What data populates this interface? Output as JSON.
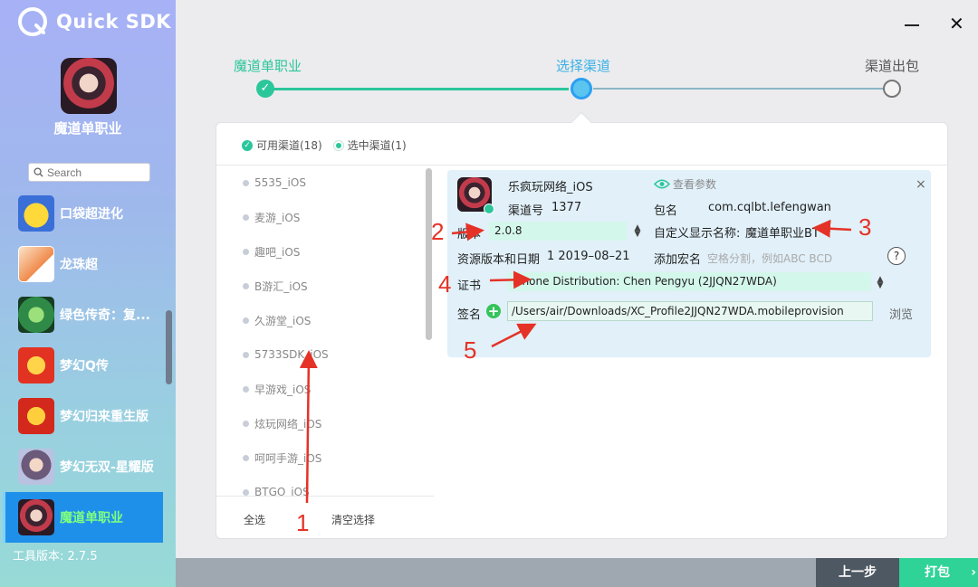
{
  "app": {
    "logo_text": "Quick SDK",
    "tool_version": "工具版本: 2.7.5"
  },
  "project": {
    "name": "魔道单职业"
  },
  "search": {
    "placeholder": "Search"
  },
  "games": [
    {
      "name": "口袋超进化",
      "color": "#3a6fd8",
      "icon": "pikachu-icon"
    },
    {
      "name": "龙珠超",
      "color": "#f08a4b",
      "icon": "dragonball-icon"
    },
    {
      "name": "绿色传奇：复...",
      "color": "#2f8a48",
      "icon": "legend-icon"
    },
    {
      "name": "梦幻Q传",
      "color": "#e23222",
      "icon": "menghuan-q-icon"
    },
    {
      "name": "梦幻归来重生版",
      "color": "#d3281c",
      "icon": "menghuan-return-icon"
    },
    {
      "name": "梦幻无双-星耀版",
      "color": "#8a8fb0",
      "icon": "menghuan-wushuang-icon"
    },
    {
      "name": "魔道单职业",
      "color": "#4b2a35",
      "icon": "modao-icon",
      "active": true
    }
  ],
  "steps": {
    "step1": "魔道单职业",
    "step1_check": "✓",
    "step2": "选择渠道",
    "step3": "渠道出包"
  },
  "tabs": {
    "available": "可用渠道(18)",
    "selected": "选中渠道(1)"
  },
  "channels": [
    "5535_iOS",
    "麦游_iOS",
    "趣吧_iOS",
    "B游汇_iOS",
    "久游堂_iOS",
    "5733SDK_iOS",
    "早游戏_iOS",
    "炫玩网络_iOS",
    "呵呵手游_iOS",
    "BTGO_iOS"
  ],
  "list_footer": {
    "select_all": "全选",
    "clear": "清空选择"
  },
  "detail": {
    "channel_name": "乐疯玩网络_iOS",
    "view_params": "查看参数",
    "channel_no_label": "渠道号",
    "channel_no": "1377",
    "package_label": "包名",
    "package": "com.cqlbt.lefengwan",
    "version_label": "版本",
    "version": "2.0.8",
    "display_name_label": "自定义显示名称:",
    "display_name": "魔道单职业BT",
    "res_version_label": "资源版本和日期",
    "res_version": "1 2019–08–21",
    "macro_label": "添加宏名",
    "macro_placeholder": "空格分割，例如ABC BCD",
    "help": "?",
    "cert_label": "证书",
    "cert": "iPhone Distribution: Chen Pengyu (2JJQN27WDA)",
    "sign_label": "签名",
    "sign_path": "/Users/air/Downloads/XC_Profile2JJQN27WDA.mobileprovision",
    "browse": "浏览",
    "close": "×"
  },
  "annotations": [
    "1",
    "2",
    "3",
    "4",
    "5"
  ],
  "footer": {
    "prev": "上一步",
    "pack": "打包",
    "pack_arrow": "›"
  },
  "window": {
    "minimize": "—",
    "close": "✕"
  },
  "colors": {
    "accent_green": "#2cc69b",
    "accent_blue": "#2b9ff2",
    "annotation_red": "#e53226"
  }
}
